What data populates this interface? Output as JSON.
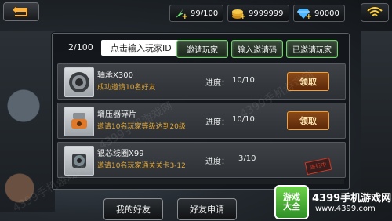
{
  "topbar": {
    "back_icon": "return-arrow-icon",
    "resources": [
      {
        "icon": "energy-icon",
        "value": "99/100"
      },
      {
        "icon": "gold-coins-icon",
        "value": "9999999"
      },
      {
        "icon": "diamond-icon",
        "value": "90000"
      }
    ],
    "wifi_icon": "wifi-signal-icon"
  },
  "panel": {
    "page_counter": "2/100",
    "id_input_placeholder": "点击输入玩家ID",
    "buttons": {
      "invite_players": "邀请玩家",
      "enter_code": "输入邀请码",
      "invited_players": "已邀请玩家"
    },
    "progress_label": "进度：",
    "items": [
      {
        "name": "轴承X300",
        "desc": "成功邀请10名好友",
        "progress": "10/10",
        "action": "领取",
        "icon": "bearing-icon"
      },
      {
        "name": "增压器碎片",
        "desc": "邀请10名玩家等级达到20级",
        "progress": "10/10",
        "action": "领取",
        "icon": "turbo-fragment-icon"
      },
      {
        "name": "银芯线圈X99",
        "desc": "邀请10名玩家通关关卡3-12",
        "progress": "3/10",
        "status": "进行中",
        "icon": "wire-coil-icon"
      }
    ]
  },
  "bottom": {
    "my_friends": "我的好友",
    "friend_requests": "好友申请"
  },
  "logo": {
    "badge_top": "游戏",
    "badge_bottom": "大全",
    "name": "4399手机游戏网",
    "url": "www.4399.com"
  },
  "watermark": "4399手机游戏网"
}
